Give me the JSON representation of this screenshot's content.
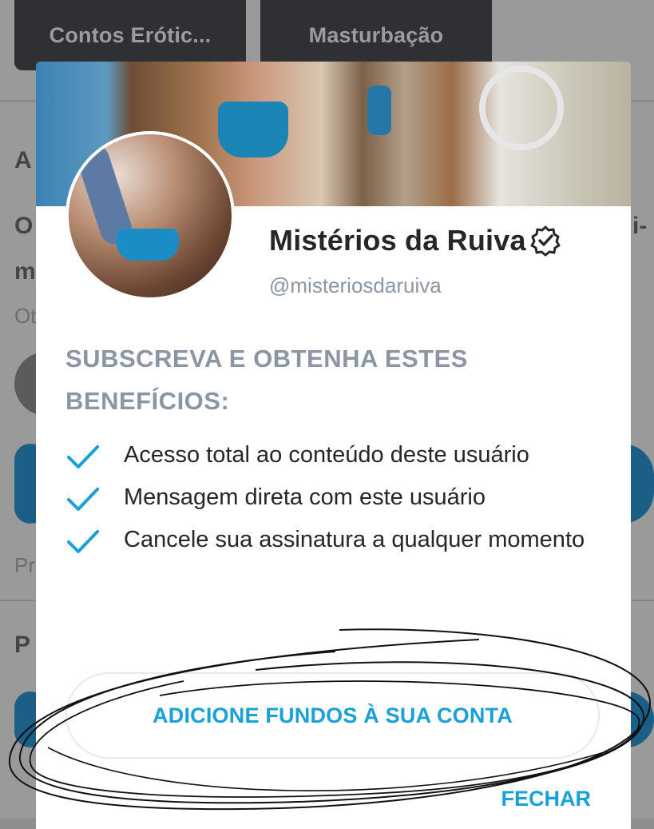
{
  "background": {
    "chips": [
      "Contos Erótic...",
      "Masturbação"
    ],
    "fragments": [
      "A",
      "O",
      "m",
      "Ot",
      "Pr",
      "P",
      "i-"
    ]
  },
  "profile": {
    "display_name": "Mistérios da Ruiva",
    "handle": "@misteriosdaruiva",
    "verified_icon": "verified-badge-icon"
  },
  "subscribe": {
    "title": "SUBSCREVA E OBTENHA ESTES BENEFÍCIOS:",
    "benefits": [
      "Acesso total ao conteúdo deste usuário",
      "Mensagem direta com este usuário",
      "Cancele sua assinatura a qualquer momento"
    ]
  },
  "actions": {
    "add_funds_label": "ADICIONE FUNDOS À SUA CONTA",
    "close_label": "FECHAR"
  },
  "colors": {
    "accent": "#1aa0d8",
    "muted_text": "#8a96a3",
    "primary_text": "#262626",
    "overlay": "#9a9a9a"
  }
}
